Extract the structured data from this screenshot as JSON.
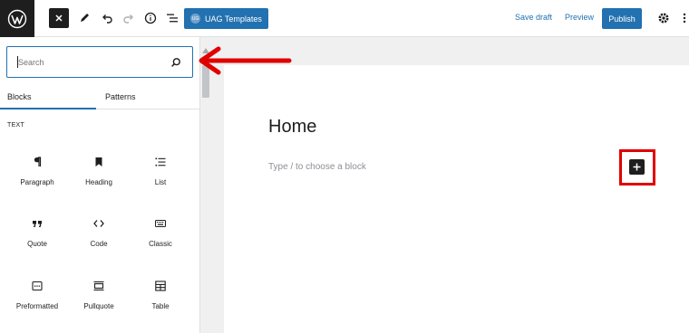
{
  "colors": {
    "accent": "#2271b1",
    "dark": "#1e1e1e",
    "annotation": "#e00000"
  },
  "toolbar": {
    "logo_icon": "wordpress-logo-icon",
    "close_icon": "close-icon",
    "tools_icon": "pencil-icon",
    "undo_icon": "undo-icon",
    "redo_icon": "redo-icon",
    "details_icon": "info-icon",
    "outline_icon": "list-view-icon",
    "uag_badge": "UG",
    "uag_label": "UAG Templates",
    "save_draft": "Save draft",
    "preview": "Preview",
    "publish": "Publish",
    "settings_icon": "gear-icon",
    "options_icon": "kebab-menu-icon"
  },
  "inserter": {
    "search_placeholder": "Search",
    "search_value": "",
    "tabs": [
      {
        "label": "Blocks",
        "active": true
      },
      {
        "label": "Patterns",
        "active": false
      }
    ],
    "section_label": "TEXT",
    "blocks": [
      {
        "label": "Paragraph",
        "icon": "pilcrow-icon"
      },
      {
        "label": "Heading",
        "icon": "bookmark-icon"
      },
      {
        "label": "List",
        "icon": "list-icon"
      },
      {
        "label": "Quote",
        "icon": "quote-icon"
      },
      {
        "label": "Code",
        "icon": "code-icon"
      },
      {
        "label": "Classic",
        "icon": "keyboard-icon"
      },
      {
        "label": "Preformatted",
        "icon": "preformatted-icon"
      },
      {
        "label": "Pullquote",
        "icon": "pullquote-icon"
      },
      {
        "label": "Table",
        "icon": "table-icon"
      }
    ]
  },
  "editor": {
    "title": "Home",
    "block_placeholder": "Type / to choose a block",
    "add_block_icon": "plus-icon"
  }
}
